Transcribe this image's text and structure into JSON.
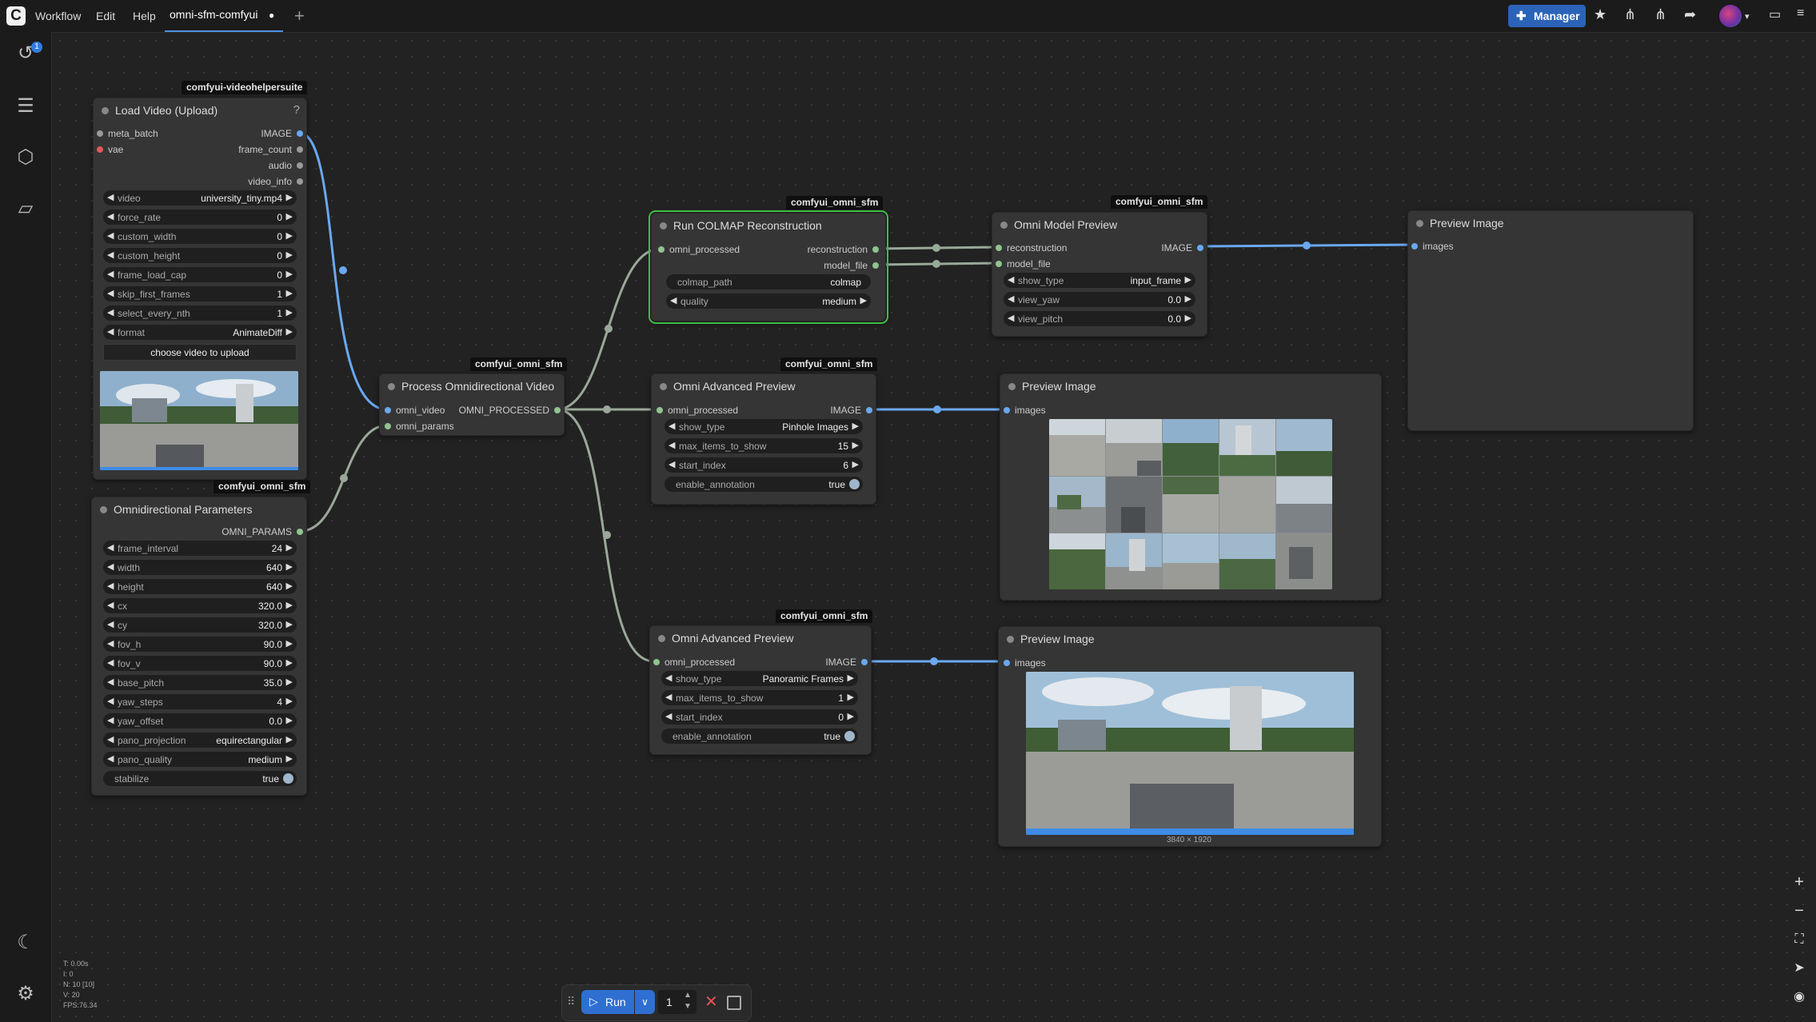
{
  "topbar": {
    "menus": [
      "Workflow",
      "Edit",
      "Help"
    ],
    "tab_name": "omni-sfm-comfyui",
    "tab_dirty": "●",
    "new_tab": "+",
    "manager_label": "Manager",
    "icons": [
      "puzzle-icon",
      "star-icon",
      "split-icon",
      "split-icon",
      "share-icon",
      "avatar",
      "layout-icon",
      "menu-icon"
    ]
  },
  "sidebar": {
    "queue_badge": "1",
    "items": [
      "history-icon",
      "document-icon",
      "cube-icon",
      "folder-icon"
    ],
    "bottom": [
      "moon-icon",
      "gear-icon"
    ]
  },
  "nodes": {
    "load_video": {
      "badge": "comfyui-videohelpersuite",
      "title": "Load Video (Upload)",
      "help": "?",
      "inputs": [
        "meta_batch",
        "vae"
      ],
      "outputs": [
        "IMAGE",
        "frame_count",
        "audio",
        "video_info"
      ],
      "widgets": [
        {
          "label": "video",
          "value": "university_tiny.mp4"
        },
        {
          "label": "force_rate",
          "value": "0"
        },
        {
          "label": "custom_width",
          "value": "0"
        },
        {
          "label": "custom_height",
          "value": "0"
        },
        {
          "label": "frame_load_cap",
          "value": "0"
        },
        {
          "label": "skip_first_frames",
          "value": "1"
        },
        {
          "label": "select_every_nth",
          "value": "1"
        },
        {
          "label": "format",
          "value": "AnimateDiff"
        }
      ],
      "upload_button": "choose video to upload"
    },
    "omni_params": {
      "badge": "comfyui_omni_sfm",
      "title": "Omnidirectional Parameters",
      "outputs": [
        "OMNI_PARAMS"
      ],
      "widgets": [
        {
          "label": "frame_interval",
          "value": "24"
        },
        {
          "label": "width",
          "value": "640"
        },
        {
          "label": "height",
          "value": "640"
        },
        {
          "label": "cx",
          "value": "320.0"
        },
        {
          "label": "cy",
          "value": "320.0"
        },
        {
          "label": "fov_h",
          "value": "90.0"
        },
        {
          "label": "fov_v",
          "value": "90.0"
        },
        {
          "label": "base_pitch",
          "value": "35.0"
        },
        {
          "label": "yaw_steps",
          "value": "4"
        },
        {
          "label": "yaw_offset",
          "value": "0.0"
        },
        {
          "label": "pano_projection",
          "value": "equirectangular"
        },
        {
          "label": "pano_quality",
          "value": "medium"
        }
      ],
      "toggle": {
        "label": "stabilize",
        "value": "true"
      }
    },
    "process_video": {
      "badge": "comfyui_omni_sfm",
      "title": "Process Omnidirectional Video",
      "inputs": [
        "omni_video",
        "omni_params"
      ],
      "outputs": [
        "OMNI_PROCESSED"
      ]
    },
    "colmap": {
      "badge": "comfyui_omni_sfm",
      "title": "Run COLMAP Reconstruction",
      "inputs": [
        "omni_processed"
      ],
      "outputs": [
        "reconstruction",
        "model_file"
      ],
      "text_widget": {
        "label": "colmap_path",
        "value": "colmap"
      },
      "widgets": [
        {
          "label": "quality",
          "value": "medium"
        }
      ]
    },
    "model_preview": {
      "badge": "comfyui_omni_sfm",
      "title": "Omni Model Preview",
      "inputs": [
        "reconstruction",
        "model_file"
      ],
      "outputs": [
        "IMAGE"
      ],
      "widgets": [
        {
          "label": "show_type",
          "value": "input_frame"
        },
        {
          "label": "view_yaw",
          "value": "0.0"
        },
        {
          "label": "view_pitch",
          "value": "0.0"
        }
      ]
    },
    "preview_right": {
      "title": "Preview Image",
      "inputs": [
        "images"
      ]
    },
    "adv_preview_1": {
      "badge": "comfyui_omni_sfm",
      "title": "Omni Advanced Preview",
      "inputs": [
        "omni_processed"
      ],
      "outputs": [
        "IMAGE"
      ],
      "widgets": [
        {
          "label": "show_type",
          "value": "Pinhole Images"
        },
        {
          "label": "max_items_to_show",
          "value": "15"
        },
        {
          "label": "start_index",
          "value": "6"
        }
      ],
      "toggle": {
        "label": "enable_annotation",
        "value": "true"
      }
    },
    "preview_mid": {
      "title": "Preview Image",
      "inputs": [
        "images"
      ]
    },
    "adv_preview_2": {
      "badge": "comfyui_omni_sfm",
      "title": "Omni Advanced Preview",
      "inputs": [
        "omni_processed"
      ],
      "outputs": [
        "IMAGE"
      ],
      "widgets": [
        {
          "label": "show_type",
          "value": "Panoramic Frames"
        },
        {
          "label": "max_items_to_show",
          "value": "1"
        },
        {
          "label": "start_index",
          "value": "0"
        }
      ],
      "toggle": {
        "label": "enable_annotation",
        "value": "true"
      }
    },
    "preview_bottom": {
      "title": "Preview Image",
      "inputs": [
        "images"
      ],
      "dims": "3840 × 1920"
    }
  },
  "runbar": {
    "run_label": "Run",
    "count": "1"
  },
  "stats": [
    "T: 0.00s",
    "I: 0",
    "N: 10 [10]",
    "V: 20",
    "FPS:76.34"
  ],
  "colors": {
    "wire_image": "#6aa8f0",
    "wire_other": "#9aa89a",
    "accent": "#2f6fd1",
    "selected_outline": "#3fbf45",
    "pin_image": "#6aa8f0",
    "pin_generic": "#8fc48f",
    "pin_red": "#e05a5a"
  }
}
